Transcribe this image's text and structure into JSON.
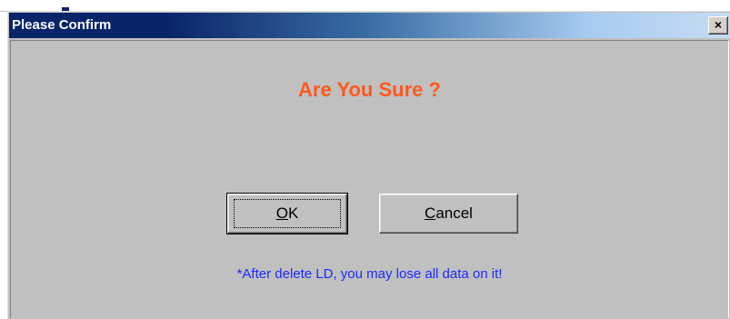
{
  "dialog": {
    "title": "Please Confirm",
    "close_glyph": "×",
    "question": "Are You Sure ?",
    "ok": {
      "mnemonic": "O",
      "rest": "K"
    },
    "cancel": {
      "mnemonic": "C",
      "rest": "ancel"
    },
    "note": "*After delete LD, you may lose all data on it!"
  },
  "colors": {
    "title_bar_start": "#0a246a",
    "dialog_bg": "#c0c0c0",
    "question_text": "#ff5a1f",
    "note_text": "#1a2bff"
  },
  "icons": {
    "close": "close-icon"
  }
}
